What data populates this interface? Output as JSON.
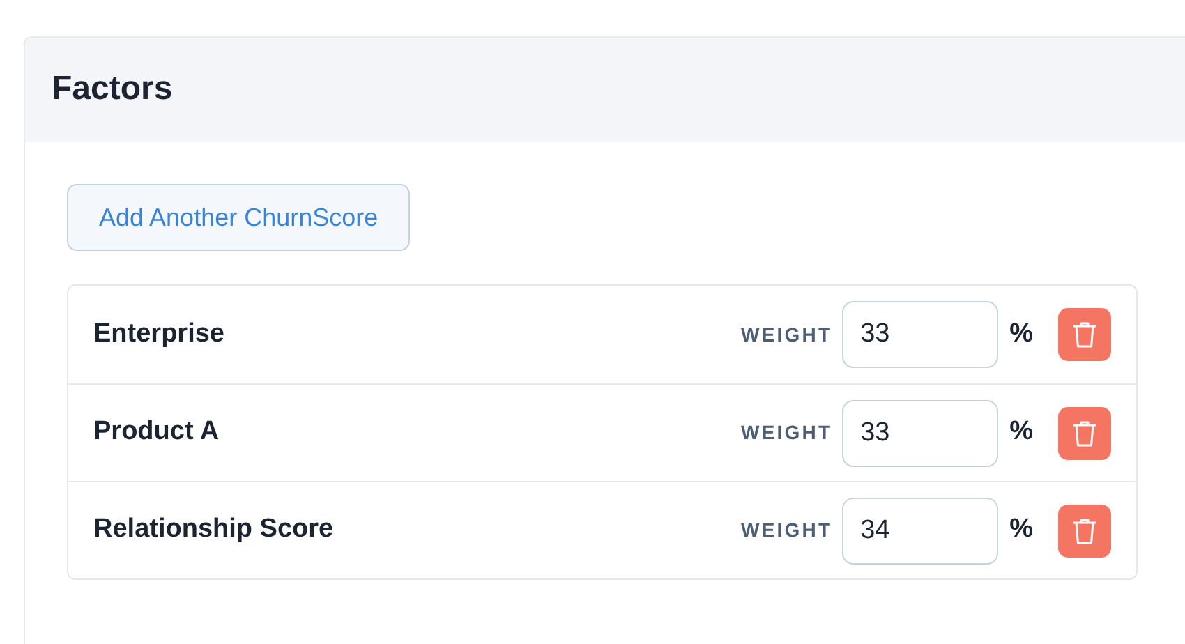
{
  "panel": {
    "title": "Factors"
  },
  "add_button": {
    "label": "Add Another ChurnScore"
  },
  "factors": [
    {
      "name": "Enterprise",
      "weight_label": "WEIGHT",
      "weight": "33",
      "unit": "%"
    },
    {
      "name": "Product A",
      "weight_label": "WEIGHT",
      "weight": "33",
      "unit": "%"
    },
    {
      "name": "Relationship Score",
      "weight_label": "WEIGHT",
      "weight": "34",
      "unit": "%"
    }
  ]
}
